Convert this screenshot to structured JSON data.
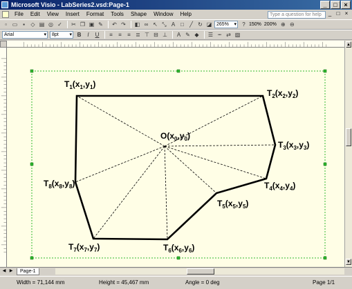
{
  "window": {
    "title": "Microsoft Visio - LabSeries2.vsd:Page-1",
    "controls": [
      "_",
      "□",
      "×"
    ]
  },
  "menubar": {
    "items": [
      "File",
      "Edit",
      "View",
      "Insert",
      "Format",
      "Tools",
      "Shape",
      "Window",
      "Help"
    ],
    "help_placeholder": "Type a question for help",
    "doc_controls": [
      "_",
      "□",
      "×"
    ]
  },
  "toolbar1": {
    "zoom": "265%",
    "zoom_150": "150%",
    "zoom_200": "200%"
  },
  "toolbar2": {
    "font": "Arial",
    "size": "8pt",
    "bold": "B",
    "italic": "I",
    "underline": "U"
  },
  "diagram": {
    "center_label": {
      "base": "O(x",
      "sub1": "0",
      "mid": ",y",
      "sub2": "0",
      "end": ")"
    },
    "points": [
      {
        "id": "T1",
        "base": "T",
        "idx": "1",
        "x": "x",
        "xs": "1",
        "y": "y",
        "ys": "1"
      },
      {
        "id": "T2",
        "base": "T",
        "idx": "2",
        "x": "x",
        "xs": "2",
        "y": "y",
        "ys": "2"
      },
      {
        "id": "T3",
        "base": "T",
        "idx": "3",
        "x": "x",
        "xs": "3",
        "y": "y",
        "ys": "3"
      },
      {
        "id": "T4",
        "base": "T",
        "idx": "4",
        "x": "x",
        "xs": "4",
        "y": "y",
        "ys": "4"
      },
      {
        "id": "T5",
        "base": "T",
        "idx": "5",
        "x": "x",
        "xs": "5",
        "y": "y",
        "ys": "5"
      },
      {
        "id": "T6",
        "base": "T",
        "idx": "6",
        "x": "x",
        "xs": "6",
        "y": "y",
        "ys": "6"
      },
      {
        "id": "T7",
        "base": "T",
        "idx": "7",
        "x": "x",
        "xs": "7",
        "y": "y",
        "ys": "7"
      },
      {
        "id": "T8",
        "base": "T",
        "idx": "8",
        "x": "x",
        "xs": "8",
        "y": "y",
        "ys": "8"
      }
    ]
  },
  "tabs": {
    "page_tab": "Page-1"
  },
  "status": {
    "width": "Width = 71,144 mm",
    "height": "Height = 45,467 mm",
    "angle": "Angle = 0 deg",
    "page": "Page 1/1"
  }
}
